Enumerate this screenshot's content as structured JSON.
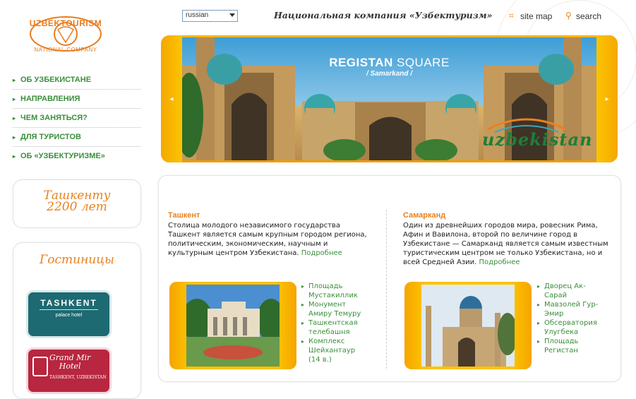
{
  "logo": {
    "top": "UZBEKTOURISM",
    "bottom": "NATIONAL COMPANY"
  },
  "header": {
    "language_selected": "russian",
    "company_title": "Национальная компания «Узбектуризм»",
    "sitemap_label": "site map",
    "search_label": "search"
  },
  "nav": {
    "items": [
      {
        "label": "ОБ УЗБЕКИСТАНЕ"
      },
      {
        "label": "НАПРАВЛЕНИЯ"
      },
      {
        "label": "ЧЕМ ЗАНЯТЬСЯ?"
      },
      {
        "label": "ДЛЯ ТУРИСТОВ"
      },
      {
        "label": "ОБ «УЗБЕКТУРИЗМЕ»"
      }
    ]
  },
  "sidebar": {
    "tashkent_banner_line1": "Ташкенту",
    "tashkent_banner_line2": "2200 лет",
    "hotels_title": "Гостиницы",
    "hotel1_name": "TASHKENT",
    "hotel1_sub": "palace hotel",
    "hotel2_name_line1": "Grand Mir",
    "hotel2_name_line2": "Hotel",
    "hotel2_sub": "TASHKENT, UZBEKISTAN"
  },
  "banner": {
    "title_bold": "REGISTAN",
    "title_rest": " SQUARE",
    "subtitle": "/ Samarkand /",
    "logo_text": "uzbekistan",
    "arrow_left": "◂",
    "arrow_right": "▸"
  },
  "content": {
    "left": {
      "title": "Ташкент",
      "text": "Столица молодого независимого государства Ташкент является самым крупным городом региона, политическим, экономическим, научным и культурным центром Узбекистана.",
      "more": "Подробнее",
      "sights": [
        "Площадь Мустакиллик",
        "Монумент Амиру Темуру",
        "Ташкентская телебашня",
        "Комплекс Шейхантаур (14 в.)"
      ]
    },
    "right": {
      "title": "Самарканд",
      "text": "Один из древнейших городов мира, ровесник Рима, Афин и Вавилона, второй по величине город в Узбекистане — Самарканд является самым известным туристическим центром не только Узбекистана, но и всей Средней Азии.",
      "more": "Подробнее",
      "sights": [
        "Дворец Ак-Сарай",
        "Мавзолей Гур-Эмир",
        "Обсерватория Улугбека",
        "Площадь Регистан"
      ]
    }
  },
  "colors": {
    "accent_orange": "#e8821f",
    "link_green": "#3a8f3c",
    "banner_yellow": "#f7b500"
  },
  "icons": {
    "sitemap": "sitemap-icon",
    "search": "search-icon"
  }
}
